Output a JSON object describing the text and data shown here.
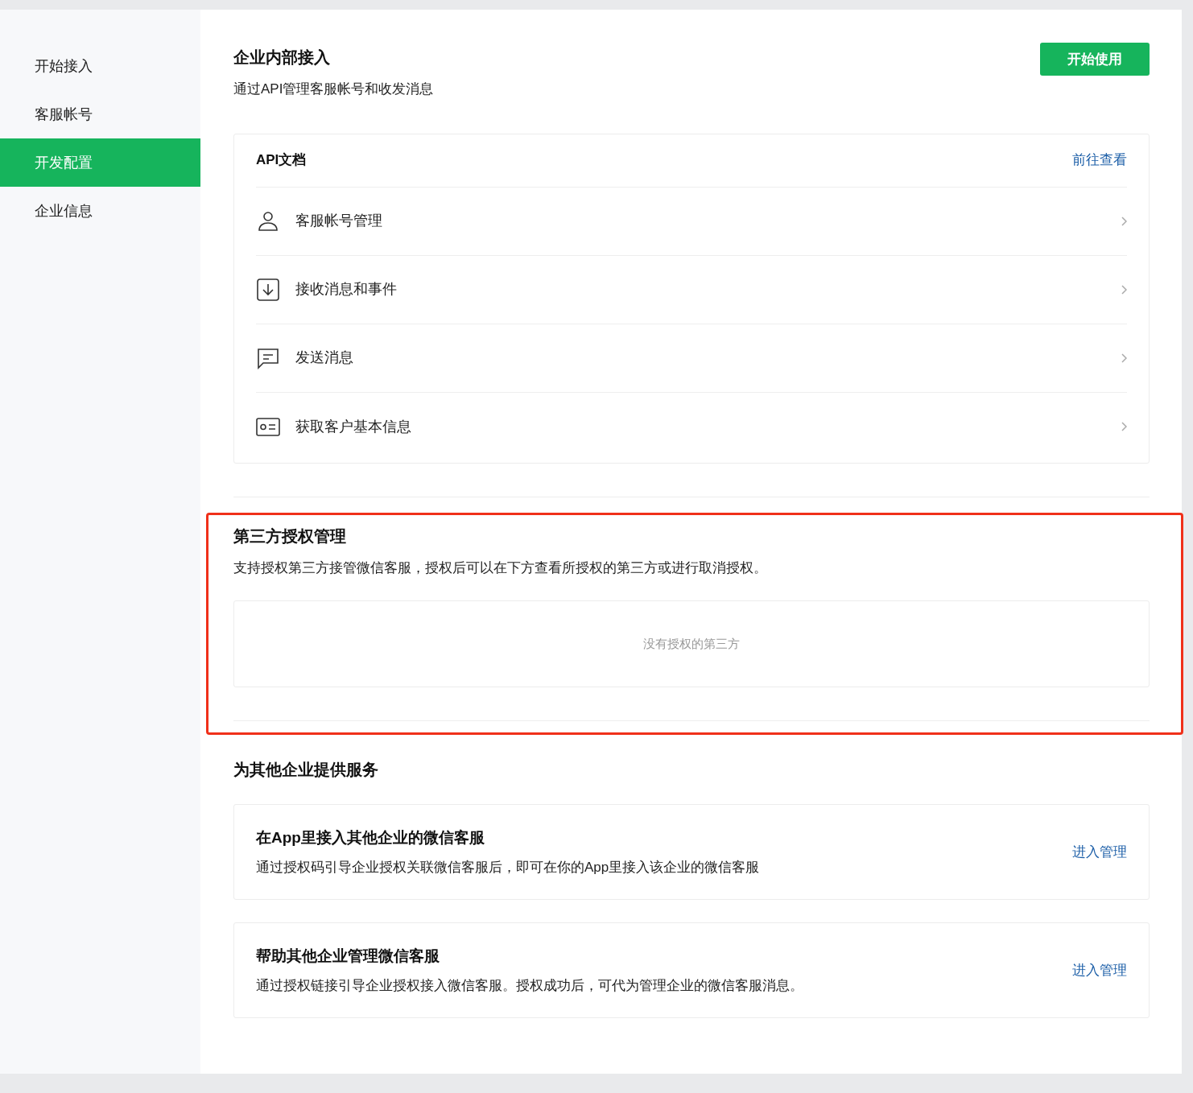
{
  "sidebar": {
    "items": [
      {
        "label": "开始接入",
        "selected": false
      },
      {
        "label": "客服帐号",
        "selected": false
      },
      {
        "label": "开发配置",
        "selected": true
      },
      {
        "label": "企业信息",
        "selected": false
      }
    ]
  },
  "header": {
    "title": "企业内部接入",
    "subtitle": "通过API管理客服帐号和收发消息",
    "button": "开始使用"
  },
  "api_docs": {
    "title": "API文档",
    "link": "前往查看",
    "items": [
      {
        "kind": "person",
        "label": "客服帐号管理"
      },
      {
        "kind": "download",
        "label": "接收消息和事件"
      },
      {
        "kind": "message",
        "label": "发送消息"
      },
      {
        "kind": "card",
        "label": "获取客户基本信息"
      }
    ]
  },
  "third_party": {
    "highlighted": true,
    "title": "第三方授权管理",
    "description": "支持授权第三方接管微信客服，授权后可以在下方查看所授权的第三方或进行取消授权。",
    "empty": "没有授权的第三方"
  },
  "services": {
    "title": "为其他企业提供服务",
    "cards": [
      {
        "title": "在App里接入其他企业的微信客服",
        "description": "通过授权码引导企业授权关联微信客服后，即可在你的App里接入该企业的微信客服",
        "link": "进入管理"
      },
      {
        "title": "帮助其他企业管理微信客服",
        "description": "通过授权链接引导企业授权接入微信客服。授权成功后，可代为管理企业的微信客服消息。",
        "link": "进入管理"
      }
    ]
  }
}
